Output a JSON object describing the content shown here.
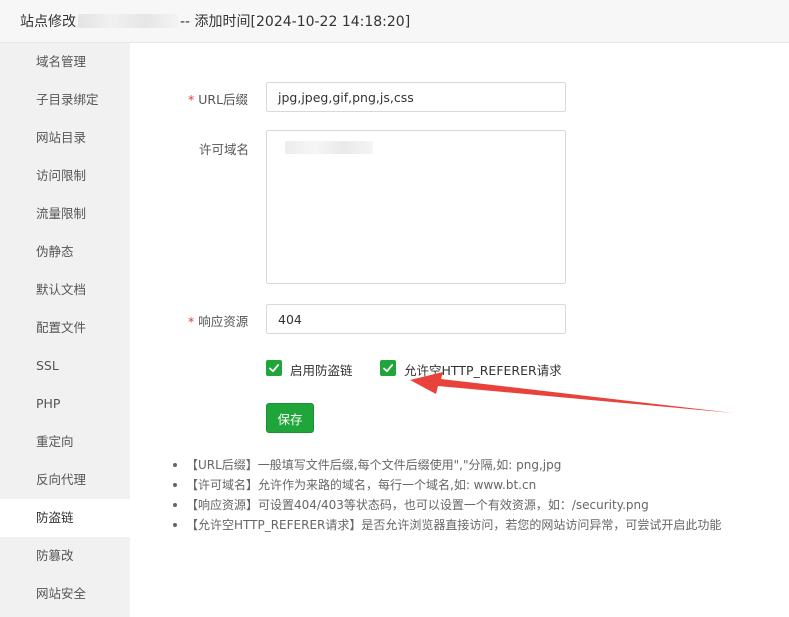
{
  "window": {
    "title_prefix": "站点修改",
    "title_suffix": "-- 添加时间[2024-10-22 14:18:20]"
  },
  "sidebar": {
    "items": [
      {
        "label": "域名管理"
      },
      {
        "label": "子目录绑定"
      },
      {
        "label": "网站目录"
      },
      {
        "label": "访问限制"
      },
      {
        "label": "流量限制"
      },
      {
        "label": "伪静态"
      },
      {
        "label": "默认文档"
      },
      {
        "label": "配置文件"
      },
      {
        "label": "SSL"
      },
      {
        "label": "PHP"
      },
      {
        "label": "重定向"
      },
      {
        "label": "反向代理"
      },
      {
        "label": "防盗链",
        "active": true
      },
      {
        "label": "防篡改"
      },
      {
        "label": "网站安全"
      }
    ]
  },
  "form": {
    "url_suffix": {
      "label": "URL后缀",
      "required": "*",
      "value": "jpg,jpeg,gif,png,js,css"
    },
    "allowed_domains": {
      "label": "许可域名"
    },
    "response_resource": {
      "label": "响应资源",
      "required": "*",
      "value": "404"
    },
    "enable_hotlink": {
      "label": "启用防盗链",
      "checked": true
    },
    "allow_empty_referer": {
      "label": "允许空HTTP_REFERER请求",
      "checked": true
    },
    "save_label": "保存"
  },
  "tips": [
    "【URL后缀】一般填写文件后缀,每个文件后缀使用\",\"分隔,如: png,jpg",
    "【许可域名】允许作为来路的域名，每行一个域名,如: www.bt.cn",
    "【响应资源】可设置404/403等状态码，也可以设置一个有效资源，如：/security.png",
    "【允许空HTTP_REFERER请求】是否允许浏览器直接访问，若您的网站访问异常，可尝试开启此功能"
  ],
  "colors": {
    "accent": "#20a53a",
    "required": "#e23b3b",
    "annotation_arrow": "#e8423a"
  }
}
